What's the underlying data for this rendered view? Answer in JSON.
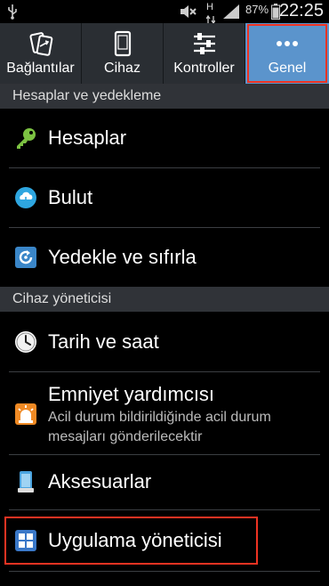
{
  "status_bar": {
    "battery": "87%",
    "time": "22:25",
    "network": "H"
  },
  "tabs": [
    {
      "label": "Bağlantılar",
      "icon": "connections-icon"
    },
    {
      "label": "Cihaz",
      "icon": "device-icon"
    },
    {
      "label": "Kontroller",
      "icon": "controls-icon"
    },
    {
      "label": "Genel",
      "icon": "more-dots-icon",
      "selected": true
    }
  ],
  "sections": [
    {
      "title": "Hesaplar ve yedekleme",
      "items": [
        {
          "title": "Hesaplar",
          "icon": "key-icon"
        },
        {
          "title": "Bulut",
          "icon": "cloud-icon"
        },
        {
          "title": "Yedekle ve sıfırla",
          "icon": "backup-reset-icon"
        }
      ]
    },
    {
      "title": "Cihaz yöneticisi",
      "items": [
        {
          "title": "Tarih ve saat",
          "icon": "clock-icon"
        },
        {
          "title": "Emniyet yardımcısı",
          "subtitle": "Acil durum bildirildiğinde acil durum mesajları gönderilecektir",
          "icon": "siren-icon"
        },
        {
          "title": "Aksesuarlar",
          "icon": "accessory-icon"
        },
        {
          "title": "Uygulama yöneticisi",
          "icon": "app-manager-icon",
          "highlighted": true
        }
      ]
    }
  ],
  "colors": {
    "selected_tab": "#5b94cc",
    "highlight_border": "#ee3322"
  }
}
